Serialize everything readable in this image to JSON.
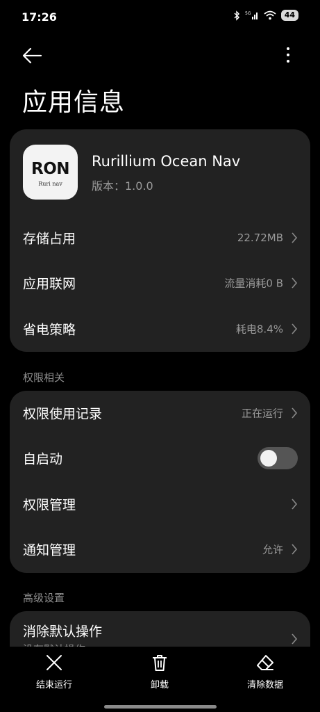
{
  "status_bar": {
    "time": "17:26",
    "battery": "44"
  },
  "header": {
    "title": "应用信息"
  },
  "app": {
    "name": "Rurillium Ocean Nav",
    "version": "版本：1.0.0",
    "icon_text": "RON",
    "icon_subtext": "Ruri nav"
  },
  "info_rows": [
    {
      "label": "存储占用",
      "value": "22.72MB"
    },
    {
      "label": "应用联网",
      "value": "流量消耗0 B"
    },
    {
      "label": "省电策略",
      "value": "耗电8.4%"
    }
  ],
  "permissions": {
    "section_title": "权限相关",
    "rows": [
      {
        "label": "权限使用记录",
        "value": "正在运行"
      },
      {
        "label": "自启动",
        "toggle": false
      },
      {
        "label": "权限管理",
        "value": ""
      },
      {
        "label": "通知管理",
        "value": "允许"
      }
    ]
  },
  "advanced": {
    "section_title": "高级设置",
    "rows": [
      {
        "label": "消除默认操作",
        "sub": "没有默认操作"
      }
    ]
  },
  "bottom_actions": [
    {
      "label": "结束运行",
      "icon": "close-icon"
    },
    {
      "label": "卸载",
      "icon": "trash-icon"
    },
    {
      "label": "清除数据",
      "icon": "eraser-icon"
    }
  ],
  "colors": {
    "background": "#000000",
    "card": "#222222",
    "secondary_text": "#9a9a9a"
  }
}
